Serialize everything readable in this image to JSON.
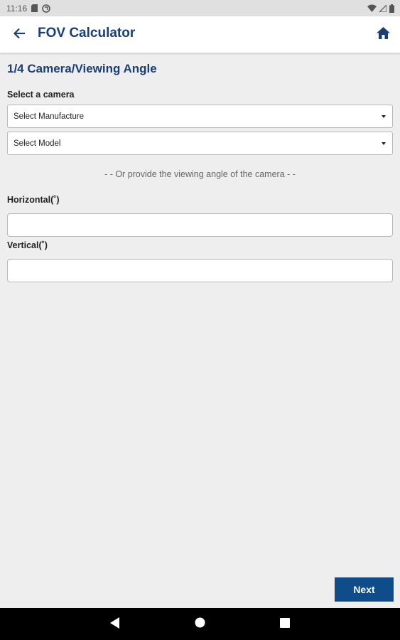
{
  "status_bar": {
    "time": "11:16"
  },
  "app_bar": {
    "title": "FOV Calculator"
  },
  "page": {
    "step_title": "1/4 Camera/Viewing Angle",
    "select_camera_label": "Select a camera",
    "manufacture_select": {
      "value": "Select Manufacture"
    },
    "model_select": {
      "value": "Select Model"
    },
    "or_text": "- - Or provide the viewing angle of the camera - -",
    "horizontal_label": "Horizontal(˚)",
    "horizontal_value": "",
    "vertical_label": "Vertical(˚)",
    "vertical_value": "",
    "next_label": "Next"
  },
  "colors": {
    "accent": "#1a3e7a",
    "button": "#0f4c8a",
    "background": "#eeeeee"
  },
  "icons": {
    "back": "arrow-left-icon",
    "home": "home-icon",
    "nav_back": "triangle-back-icon",
    "nav_home": "circle-home-icon",
    "nav_recents": "square-recents-icon"
  }
}
